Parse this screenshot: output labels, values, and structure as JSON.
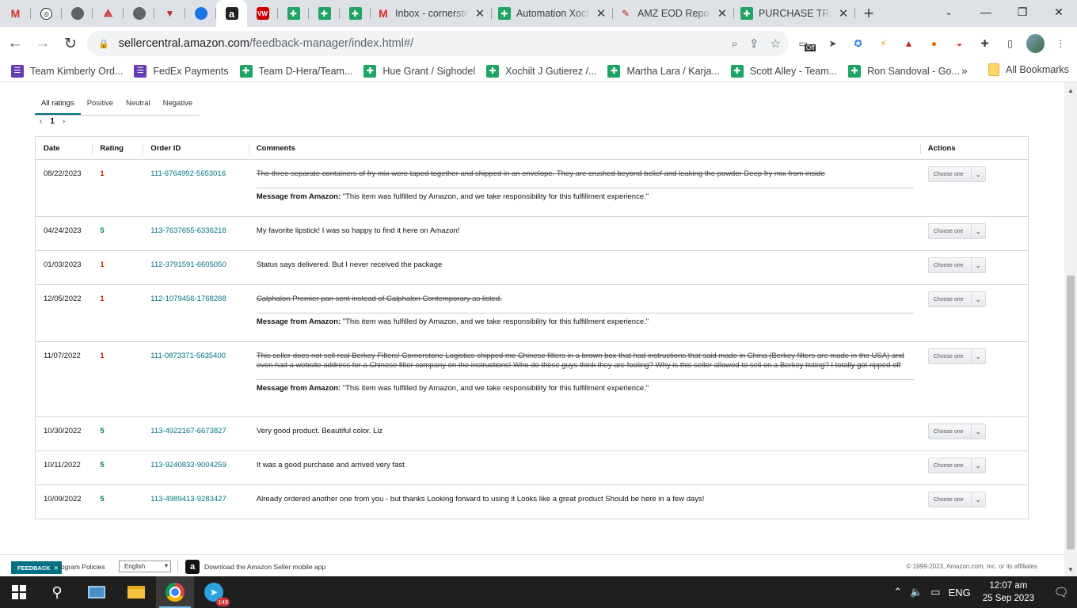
{
  "browser": {
    "tabs_pinned_icons": [
      "gmail-icon",
      "chatgpt-icon",
      "globe-icon",
      "pdf-icon",
      "globe-icon",
      "vivaldi-icon",
      "blue-app-icon",
      "amazon-icon",
      "vw-icon",
      "sheets-icon",
      "sheets-icon",
      "sheets-icon"
    ],
    "tabs": [
      {
        "title": "Inbox - cornerstone",
        "icon": "gmail-icon"
      },
      {
        "title": "Automation Xochilt",
        "icon": "sheets-icon"
      },
      {
        "title": "AMZ EOD Report",
        "icon": "pen-icon"
      },
      {
        "title": "PURCHASE TRACKER",
        "icon": "sheets-icon"
      }
    ],
    "close_glyph": "✕",
    "newtab_glyph": "+",
    "url_host": "sellercentral.amazon.com",
    "url_path": "/feedback-manager/index.html#/",
    "extension_off_badge": "Off",
    "bookmarks": [
      {
        "label": "Team Kimberly Ord...",
        "icon": "list-icon"
      },
      {
        "label": "FedEx Payments",
        "icon": "list-icon"
      },
      {
        "label": "Team D-Hera/Team...",
        "icon": "sheets-icon"
      },
      {
        "label": "Hue Grant / Sighodel",
        "icon": "sheets-icon"
      },
      {
        "label": "Xochilt J Gutierez /...",
        "icon": "sheets-icon"
      },
      {
        "label": "Martha Lara / Karja...",
        "icon": "sheets-icon"
      },
      {
        "label": "Scott Alley - Team...",
        "icon": "sheets-icon"
      },
      {
        "label": "Ron Sandoval - Go...",
        "icon": "sheets-icon"
      }
    ],
    "bookmarks_more": "»",
    "all_bookmarks": "All Bookmarks"
  },
  "feedback": {
    "filters": [
      "All ratings",
      "Positive",
      "Neutral",
      "Negative"
    ],
    "active_filter": "All ratings",
    "pager": {
      "prev": "‹",
      "page": "1",
      "next": "›"
    },
    "columns": {
      "date": "Date",
      "rating": "Rating",
      "order_id": "Order ID",
      "comments": "Comments",
      "actions": "Actions"
    },
    "action_placeholder": "Choose one",
    "amazon_msg_label": "Message from Amazon:",
    "amazon_msg_text": "\"This item was fulfilled by Amazon, and we take responsibility for this fulfillment experience.\"",
    "rows": [
      {
        "date": "08/22/2023",
        "rating": "1",
        "order_id": "111-6764992-5653016",
        "comment": "The three separate containers of fry mix were taped together and shipped in an envelope. They are crushed beyond belief and leaking the powder Deep fry mix from inside",
        "struck": true
      },
      {
        "date": "04/24/2023",
        "rating": "5",
        "order_id": "113-7637655-6336218",
        "comment": "My favorite lipstick! I was so happy to find it here on Amazon!",
        "struck": false
      },
      {
        "date": "01/03/2023",
        "rating": "1",
        "order_id": "112-3791591-6605050",
        "comment": "Status says delivered. But I never received the package",
        "struck": false
      },
      {
        "date": "12/05/2022",
        "rating": "1",
        "order_id": "112-1079456-1768268",
        "comment": "Calphalon Premier pan sent instead of Calphalon Contemporary as listed.",
        "struck": true
      },
      {
        "date": "11/07/2022",
        "rating": "1",
        "order_id": "111-0873371-5635400",
        "comment": "This seller does not sell real Berkey Filters! Cornerstone Logistics shipped me Chinese filters in a brown box that had instructions that said made in China (Berkey filters are made in the USA) and even had a website address for a Chinese filter company on the instructions! Who do these guys think they are fooling? Why is this seller allowed to sell on a Berkey listing? I totally got ripped off",
        "struck": true
      },
      {
        "date": "10/30/2022",
        "rating": "5",
        "order_id": "113-4922167-6673827",
        "comment": "Very good product. Beautiful color. Liz",
        "struck": false
      },
      {
        "date": "10/11/2022",
        "rating": "5",
        "order_id": "113-9240833-9004259",
        "comment": "It was a good purchase and arrived very fast",
        "struck": false
      },
      {
        "date": "10/09/2022",
        "rating": "5",
        "order_id": "113-4989413-9283427",
        "comment": "Already ordered another one from you - but thanks Looking forward to using it Looks like a great product Should be here in a few days!",
        "struck": false
      }
    ]
  },
  "footer": {
    "feedback_button": "FEEDBACK",
    "feedback_close": "✕",
    "program_policies": "rogram Policies",
    "language": "English",
    "app_download": "Download the Amazon Seller mobile app",
    "copyright": "© 1999-2023, Amazon.com, Inc. or its affiliates"
  },
  "taskbar": {
    "telegram_badge": "149",
    "language": "ENG",
    "time": "12:07 am",
    "date": "25 Sep 2023"
  }
}
